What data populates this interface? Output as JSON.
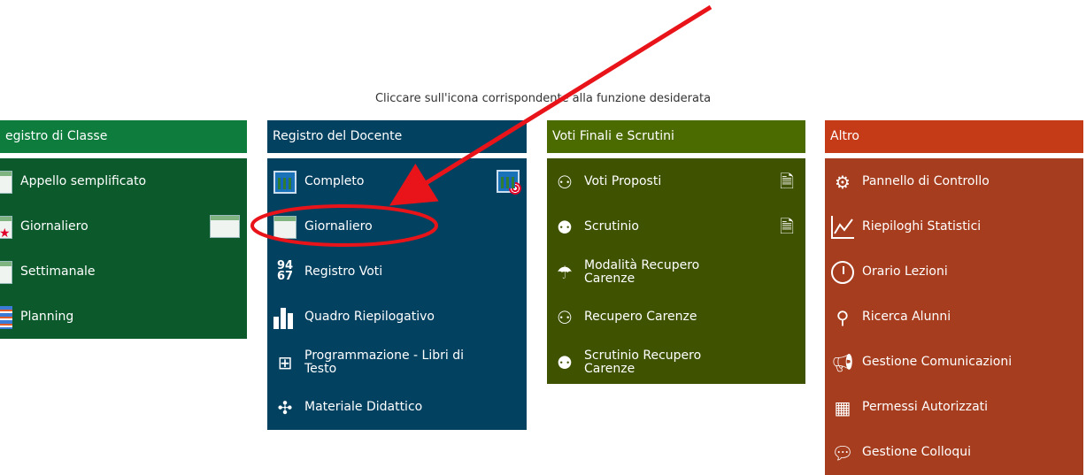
{
  "instruction": "Cliccare sull'icona corrispondente alla funzione desiderata",
  "panels": [
    {
      "title": "egistro di Classe",
      "items": [
        {
          "label": "Appello semplificato"
        },
        {
          "label": "Giornaliero"
        },
        {
          "label": "Settimanale"
        },
        {
          "label": "Planning"
        }
      ]
    },
    {
      "title": "Registro del Docente",
      "items": [
        {
          "label": "Completo"
        },
        {
          "label": "Giornaliero"
        },
        {
          "label": "Registro Voti"
        },
        {
          "label": "Quadro Riepilogativo"
        },
        {
          "label": "Programmazione - Libri di Testo"
        },
        {
          "label": "Materiale Didattico"
        }
      ]
    },
    {
      "title": "Voti Finali e Scrutini",
      "items": [
        {
          "label": "Voti Proposti"
        },
        {
          "label": "Scrutinio"
        },
        {
          "label": "Modalità Recupero Carenze"
        },
        {
          "label": "Recupero Carenze"
        },
        {
          "label": "Scrutinio Recupero Carenze"
        }
      ]
    },
    {
      "title": "Altro",
      "items": [
        {
          "label": "Pannello di Controllo"
        },
        {
          "label": "Riepiloghi Statistici"
        },
        {
          "label": "Orario Lezioni"
        },
        {
          "label": "Ricerca Alunni"
        },
        {
          "label": "Gestione Comunicazioni"
        },
        {
          "label": "Permessi Autorizzati"
        },
        {
          "label": "Gestione Colloqui"
        }
      ]
    }
  ],
  "annotation": {
    "arrow_color": "#e8141a",
    "highlight_color": "#e8141a"
  }
}
